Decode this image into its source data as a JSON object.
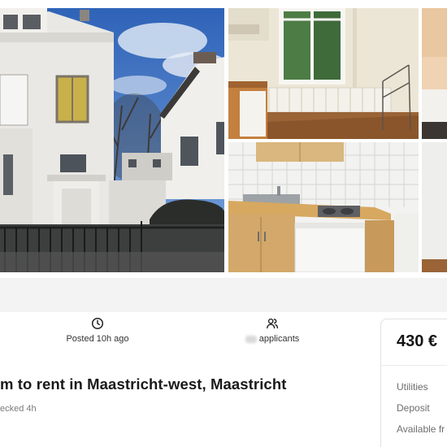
{
  "gallery": {
    "photos": [
      {
        "name": "exterior",
        "icon": "house-exterior-photo"
      },
      {
        "name": "room-window",
        "icon": "room-window-photo"
      },
      {
        "name": "kitchenette",
        "icon": "kitchen-photo"
      },
      {
        "name": "bedroom",
        "icon": "bedroom-photo"
      },
      {
        "name": "side",
        "icon": "room-photo"
      }
    ]
  },
  "meta": {
    "posted": "Posted 10h ago",
    "posted_icon": "clock-icon",
    "applicants": "applicants",
    "applicants_icon": "users-icon"
  },
  "listing": {
    "title": "m to rent in Maastricht-west, Maastricht",
    "checked": "ecked 4h"
  },
  "price_card": {
    "price": "430 €",
    "utilities": "Utilities",
    "deposit": "Deposit",
    "available": "Available fr"
  },
  "colors": {
    "accent_dark": "#141414",
    "muted": "#6e6e6e",
    "band": "#f3f3f3"
  }
}
